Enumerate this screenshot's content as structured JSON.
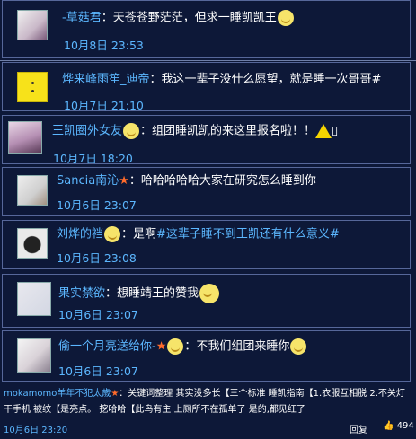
{
  "comments": [
    {
      "name": "-草菇君",
      "text": "：天苍苍野茫茫，但求一睡凯凯王",
      "time": "10月8日 23:53"
    },
    {
      "name": "烨来峰雨笙_迪帝",
      "text": "：我这一辈子没什么愿望，就是睡一次哥哥#",
      "time": "10月7日 21:10"
    },
    {
      "name": "王凯圈外女友",
      "text": "：组团睡凯凯的来这里报名啦！！",
      "suffix": "▯",
      "time": "10月7日 18:20"
    },
    {
      "name": "Sancia南沁",
      "text": "：哈哈哈哈哈大家在研究怎么睡到你",
      "time": "10月6日 23:07"
    },
    {
      "name": "刘烨的裆",
      "text": "：是啊",
      "hashtag": "#这辈子睡不到王凯还有什么意义#",
      "time": "10月6日 23:08"
    },
    {
      "name": "果实禁欲",
      "text": "：想睡靖王的赞我",
      "time": "10月6日 23:07"
    },
    {
      "name": "偷一个月亮送给你-",
      "text": "：不我们组团来睡你",
      "time": "10月6日 23:07"
    }
  ],
  "footer": {
    "name": "mokamomo羊年不犯太歳",
    "text1": "：关键词整理 其实没多长【三个标准 睡凯指南【1.衣服互相脱 2.不关灯",
    "text2": "干手机 被纹【是亮点。 挖哈哈【此鸟有主 上厕所不在孤单了 是的,都见红了",
    "time": "10月6日 23:20",
    "reply_label": "回复",
    "like_count": "494"
  }
}
